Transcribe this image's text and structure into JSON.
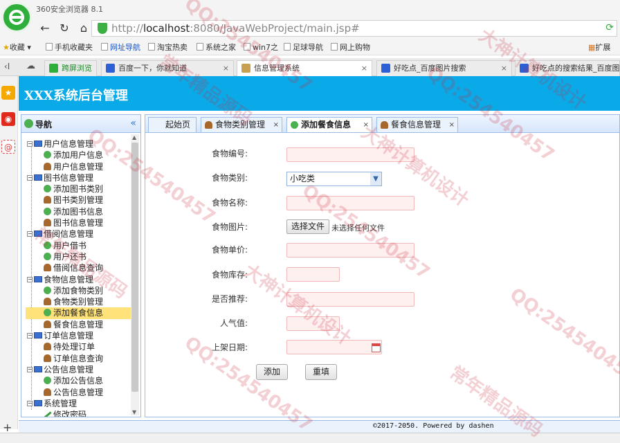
{
  "browser": {
    "window_title": "360安全浏览器 8.1",
    "url_prefix": "http://",
    "url_host": "localhost",
    "url_rest": ":8080/JavaWebProject/main.jsp#",
    "bookmarks": [
      "收藏",
      "手机收藏夹",
      "网址导航",
      "淘宝热卖",
      "系统之家",
      "win7之",
      "足球导航",
      "网上购物"
    ],
    "bookmarks_extend": "扩展",
    "tabs": [
      {
        "label": "跨屏浏览"
      },
      {
        "label": "百度一下，你就知道"
      },
      {
        "label": "信息管理系统"
      },
      {
        "label": "好吃点_百度图片搜索"
      },
      {
        "label": "好吃点的搜索结果_百度图片"
      }
    ]
  },
  "app": {
    "title": "XXX系统后台管理"
  },
  "nav": {
    "title": "导航",
    "groups": [
      {
        "label": "用户信息管理",
        "items": [
          "添加用户信息",
          "用户信息管理"
        ]
      },
      {
        "label": "图书信息管理",
        "items": [
          "添加图书类别",
          "图书类别管理",
          "添加图书信息",
          "图书信息管理"
        ]
      },
      {
        "label": "借阅信息管理",
        "items": [
          "用户借书",
          "用户还书",
          "借阅信息查询"
        ]
      },
      {
        "label": "食物信息管理",
        "items": [
          "添加食物类别",
          "食物类别管理",
          "添加餐食信息",
          "餐食信息管理"
        ]
      },
      {
        "label": "订单信息管理",
        "items": [
          "待处理订单",
          "订单信息查询"
        ]
      },
      {
        "label": "公告信息管理",
        "items": [
          "添加公告信息",
          "公告信息管理"
        ]
      },
      {
        "label": "系统管理",
        "items": [
          "修改密码"
        ]
      }
    ]
  },
  "content_tabs": [
    {
      "label": "起始页"
    },
    {
      "label": "食物类别管理"
    },
    {
      "label": "添加餐食信息"
    },
    {
      "label": "餐食信息管理"
    }
  ],
  "form": {
    "food_id_label": "食物编号:",
    "food_id_value": "",
    "category_label": "食物类别:",
    "category_value": "小吃类",
    "name_label": "食物名称:",
    "name_value": "",
    "image_label": "食物图片:",
    "file_button": "选择文件",
    "file_status": "未选择任何文件",
    "price_label": "食物单价:",
    "price_value": "",
    "stock_label": "食物库存:",
    "stock_value": "",
    "recommend_label": "是否推荐:",
    "recommend_value": "",
    "popularity_label": "人气值:",
    "popularity_value": "",
    "date_label": "上架日期:",
    "date_value": "",
    "add_button": "添加",
    "reset_button": "重填"
  },
  "footer": {
    "text": "©2017-2050. Powered by dashen"
  },
  "watermarks": [
    "QQ:254540457",
    "大神计算机设计",
    "常年精品源码"
  ],
  "colors": {
    "header": "#0aaae8",
    "panel_border": "#99bbe8",
    "selected": "#ffe27a",
    "invalid_field": "#fff0f0"
  }
}
